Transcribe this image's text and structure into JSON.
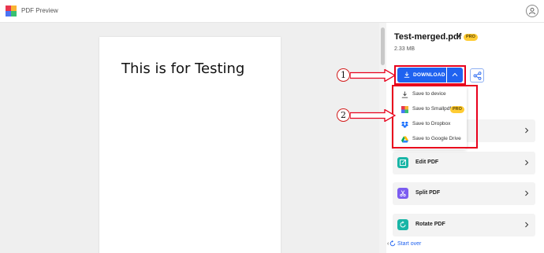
{
  "app": {
    "title": "PDF Preview"
  },
  "document": {
    "text": "This is for Testing"
  },
  "panel": {
    "file_name": "Test-merged.pdf",
    "pro_badge": "PRO",
    "file_size": "2.33 MB",
    "download_label": "DOWNLOAD",
    "dropdown": [
      {
        "label": "Save to device",
        "icon": "download-icon"
      },
      {
        "label": "Save to Smallpdf",
        "icon": "smallpdf-icon",
        "badge": "PRO"
      },
      {
        "label": "Save to Dropbox",
        "icon": "dropbox-icon"
      },
      {
        "label": "Save to Google Drive",
        "icon": "google-drive-icon"
      }
    ],
    "tools": [
      {
        "label": "Edit PDF",
        "icon": "edit-pdf-icon",
        "color": "#19b5a6"
      },
      {
        "label": "Split PDF",
        "icon": "split-pdf-icon",
        "color": "#7b5cf0"
      },
      {
        "label": "Rotate PDF",
        "icon": "rotate-pdf-icon",
        "color": "#19b5a6"
      }
    ],
    "start_over": "Start over"
  },
  "annotations": {
    "step_1": "1",
    "step_2": "2"
  },
  "colors": {
    "primary": "#1f62f0",
    "annotation_red": "#e8001c",
    "pro_yellow": "#ffcc33"
  }
}
